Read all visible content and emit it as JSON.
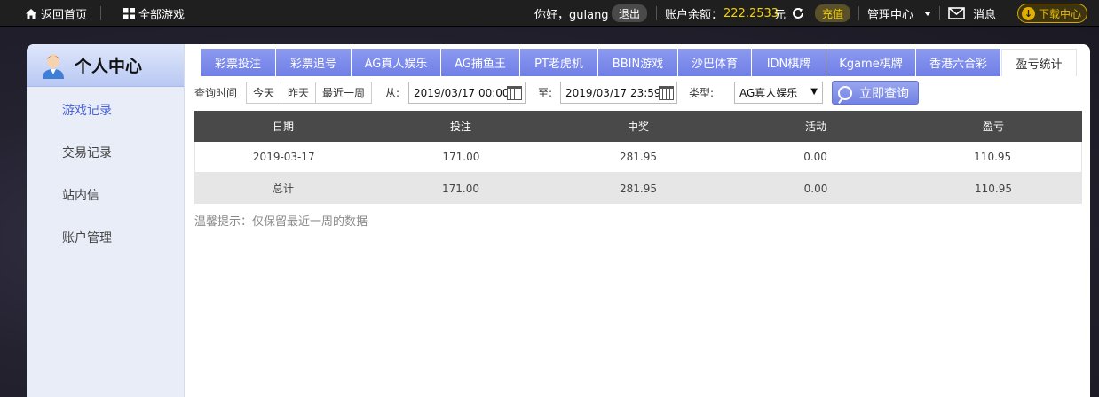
{
  "topbar": {
    "home": "返回首页",
    "all_games": "全部游戏",
    "greeting": "你好，gulang",
    "logout": "退出",
    "balance_label": "账户余额：",
    "balance_value": "222.2533",
    "currency": "元",
    "recharge": "充值",
    "manage": "管理中心",
    "messages": "消息",
    "download": "下载中心"
  },
  "sidebar": {
    "title": "个人中心",
    "items": [
      {
        "label": "游戏记录"
      },
      {
        "label": "交易记录"
      },
      {
        "label": "站内信"
      },
      {
        "label": "账户管理"
      }
    ]
  },
  "tabs": [
    {
      "label": "彩票投注"
    },
    {
      "label": "彩票追号"
    },
    {
      "label": "AG真人娱乐"
    },
    {
      "label": "AG捕鱼王"
    },
    {
      "label": "PT老虎机"
    },
    {
      "label": "BBIN游戏"
    },
    {
      "label": "沙巴体育"
    },
    {
      "label": "IDN棋牌"
    },
    {
      "label": "Kgame棋牌"
    },
    {
      "label": "香港六合彩"
    },
    {
      "label": "盈亏统计"
    }
  ],
  "filter": {
    "query_time_label": "查询时间",
    "today": "今天",
    "yesterday": "昨天",
    "last_week": "最近一周",
    "from_label": "从:",
    "from_value": "2019/03/17 00:00",
    "to_label": "至:",
    "to_value": "2019/03/17 23:59",
    "type_label": "类型:",
    "type_value": "AG真人娱乐",
    "query_button": "立即查询"
  },
  "table": {
    "headers": [
      "日期",
      "投注",
      "中奖",
      "活动",
      "盈亏"
    ],
    "rows": [
      [
        "2019-03-17",
        "171.00",
        "281.95",
        "0.00",
        "110.95"
      ],
      [
        "总计",
        "171.00",
        "281.95",
        "0.00",
        "110.95"
      ]
    ]
  },
  "tip": "温馨提示：仅保留最近一周的数据",
  "colors": {
    "accent": "#7282e4",
    "balance": "#f5d200",
    "table_header": "#494949"
  }
}
